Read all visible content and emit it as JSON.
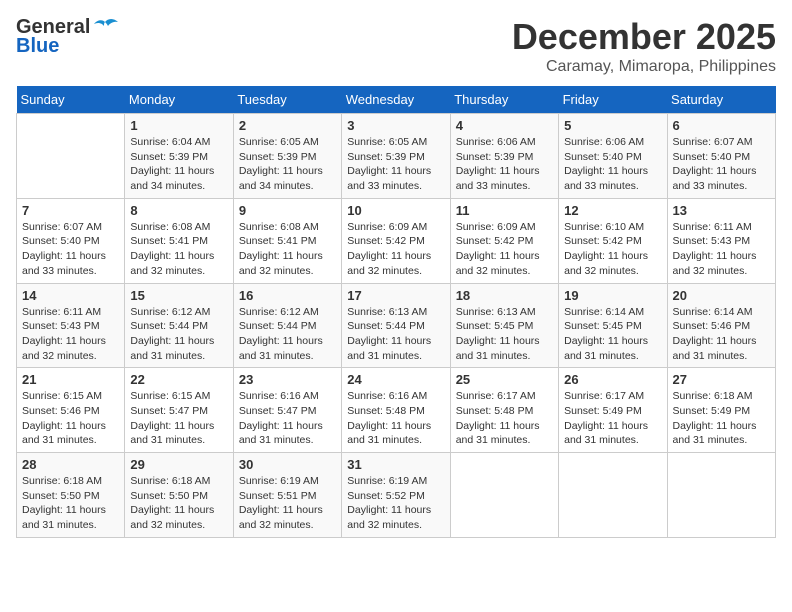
{
  "header": {
    "logo_general": "General",
    "logo_blue": "Blue",
    "month_title": "December 2025",
    "location": "Caramay, Mimaropa, Philippines"
  },
  "days_of_week": [
    "Sunday",
    "Monday",
    "Tuesday",
    "Wednesday",
    "Thursday",
    "Friday",
    "Saturday"
  ],
  "weeks": [
    [
      {
        "day": "",
        "info": ""
      },
      {
        "day": "1",
        "info": "Sunrise: 6:04 AM\nSunset: 5:39 PM\nDaylight: 11 hours\nand 34 minutes."
      },
      {
        "day": "2",
        "info": "Sunrise: 6:05 AM\nSunset: 5:39 PM\nDaylight: 11 hours\nand 34 minutes."
      },
      {
        "day": "3",
        "info": "Sunrise: 6:05 AM\nSunset: 5:39 PM\nDaylight: 11 hours\nand 33 minutes."
      },
      {
        "day": "4",
        "info": "Sunrise: 6:06 AM\nSunset: 5:39 PM\nDaylight: 11 hours\nand 33 minutes."
      },
      {
        "day": "5",
        "info": "Sunrise: 6:06 AM\nSunset: 5:40 PM\nDaylight: 11 hours\nand 33 minutes."
      },
      {
        "day": "6",
        "info": "Sunrise: 6:07 AM\nSunset: 5:40 PM\nDaylight: 11 hours\nand 33 minutes."
      }
    ],
    [
      {
        "day": "7",
        "info": "Sunrise: 6:07 AM\nSunset: 5:40 PM\nDaylight: 11 hours\nand 33 minutes."
      },
      {
        "day": "8",
        "info": "Sunrise: 6:08 AM\nSunset: 5:41 PM\nDaylight: 11 hours\nand 32 minutes."
      },
      {
        "day": "9",
        "info": "Sunrise: 6:08 AM\nSunset: 5:41 PM\nDaylight: 11 hours\nand 32 minutes."
      },
      {
        "day": "10",
        "info": "Sunrise: 6:09 AM\nSunset: 5:42 PM\nDaylight: 11 hours\nand 32 minutes."
      },
      {
        "day": "11",
        "info": "Sunrise: 6:09 AM\nSunset: 5:42 PM\nDaylight: 11 hours\nand 32 minutes."
      },
      {
        "day": "12",
        "info": "Sunrise: 6:10 AM\nSunset: 5:42 PM\nDaylight: 11 hours\nand 32 minutes."
      },
      {
        "day": "13",
        "info": "Sunrise: 6:11 AM\nSunset: 5:43 PM\nDaylight: 11 hours\nand 32 minutes."
      }
    ],
    [
      {
        "day": "14",
        "info": "Sunrise: 6:11 AM\nSunset: 5:43 PM\nDaylight: 11 hours\nand 32 minutes."
      },
      {
        "day": "15",
        "info": "Sunrise: 6:12 AM\nSunset: 5:44 PM\nDaylight: 11 hours\nand 31 minutes."
      },
      {
        "day": "16",
        "info": "Sunrise: 6:12 AM\nSunset: 5:44 PM\nDaylight: 11 hours\nand 31 minutes."
      },
      {
        "day": "17",
        "info": "Sunrise: 6:13 AM\nSunset: 5:44 PM\nDaylight: 11 hours\nand 31 minutes."
      },
      {
        "day": "18",
        "info": "Sunrise: 6:13 AM\nSunset: 5:45 PM\nDaylight: 11 hours\nand 31 minutes."
      },
      {
        "day": "19",
        "info": "Sunrise: 6:14 AM\nSunset: 5:45 PM\nDaylight: 11 hours\nand 31 minutes."
      },
      {
        "day": "20",
        "info": "Sunrise: 6:14 AM\nSunset: 5:46 PM\nDaylight: 11 hours\nand 31 minutes."
      }
    ],
    [
      {
        "day": "21",
        "info": "Sunrise: 6:15 AM\nSunset: 5:46 PM\nDaylight: 11 hours\nand 31 minutes."
      },
      {
        "day": "22",
        "info": "Sunrise: 6:15 AM\nSunset: 5:47 PM\nDaylight: 11 hours\nand 31 minutes."
      },
      {
        "day": "23",
        "info": "Sunrise: 6:16 AM\nSunset: 5:47 PM\nDaylight: 11 hours\nand 31 minutes."
      },
      {
        "day": "24",
        "info": "Sunrise: 6:16 AM\nSunset: 5:48 PM\nDaylight: 11 hours\nand 31 minutes."
      },
      {
        "day": "25",
        "info": "Sunrise: 6:17 AM\nSunset: 5:48 PM\nDaylight: 11 hours\nand 31 minutes."
      },
      {
        "day": "26",
        "info": "Sunrise: 6:17 AM\nSunset: 5:49 PM\nDaylight: 11 hours\nand 31 minutes."
      },
      {
        "day": "27",
        "info": "Sunrise: 6:18 AM\nSunset: 5:49 PM\nDaylight: 11 hours\nand 31 minutes."
      }
    ],
    [
      {
        "day": "28",
        "info": "Sunrise: 6:18 AM\nSunset: 5:50 PM\nDaylight: 11 hours\nand 31 minutes."
      },
      {
        "day": "29",
        "info": "Sunrise: 6:18 AM\nSunset: 5:50 PM\nDaylight: 11 hours\nand 32 minutes."
      },
      {
        "day": "30",
        "info": "Sunrise: 6:19 AM\nSunset: 5:51 PM\nDaylight: 11 hours\nand 32 minutes."
      },
      {
        "day": "31",
        "info": "Sunrise: 6:19 AM\nSunset: 5:52 PM\nDaylight: 11 hours\nand 32 minutes."
      },
      {
        "day": "",
        "info": ""
      },
      {
        "day": "",
        "info": ""
      },
      {
        "day": "",
        "info": ""
      }
    ]
  ]
}
